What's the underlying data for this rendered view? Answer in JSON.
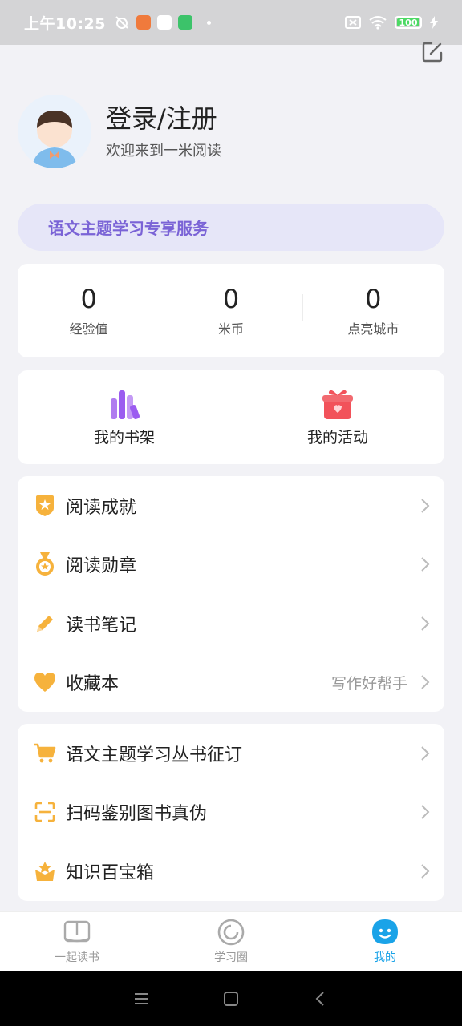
{
  "status_bar": {
    "time": "上午10:25",
    "battery": "100"
  },
  "profile": {
    "title": "登录/注册",
    "subtitle": "欢迎来到一米阅读"
  },
  "banner": {
    "label": "语文主题学习专享服务"
  },
  "stats": [
    {
      "value": "0",
      "label": "经验值"
    },
    {
      "value": "0",
      "label": "米币"
    },
    {
      "value": "0",
      "label": "点亮城市"
    }
  ],
  "quick": [
    {
      "label": "我的书架",
      "icon": "bookshelf-icon"
    },
    {
      "label": "我的活动",
      "icon": "gift-icon"
    }
  ],
  "menu1": [
    {
      "label": "阅读成就",
      "icon": "star-shield-icon",
      "extra": ""
    },
    {
      "label": "阅读勋章",
      "icon": "medal-icon",
      "extra": ""
    },
    {
      "label": "读书笔记",
      "icon": "pencil-icon",
      "extra": ""
    },
    {
      "label": "收藏本",
      "icon": "heart-icon",
      "extra": "写作好帮手"
    }
  ],
  "menu2": [
    {
      "label": "语文主题学习丛书征订",
      "icon": "cart-icon"
    },
    {
      "label": "扫码鉴别图书真伪",
      "icon": "scan-icon"
    },
    {
      "label": "知识百宝箱",
      "icon": "treasure-box-icon"
    }
  ],
  "tabs": [
    {
      "label": "一起读书",
      "icon": "book-icon",
      "active": false
    },
    {
      "label": "学习圈",
      "icon": "circle-icon",
      "active": false
    },
    {
      "label": "我的",
      "icon": "face-icon",
      "active": true
    }
  ],
  "colors": {
    "accent": "#1aa3e8",
    "banner_text": "#7a63d6",
    "icon_orange": "#f6b23c",
    "background": "#f2f2f6"
  }
}
